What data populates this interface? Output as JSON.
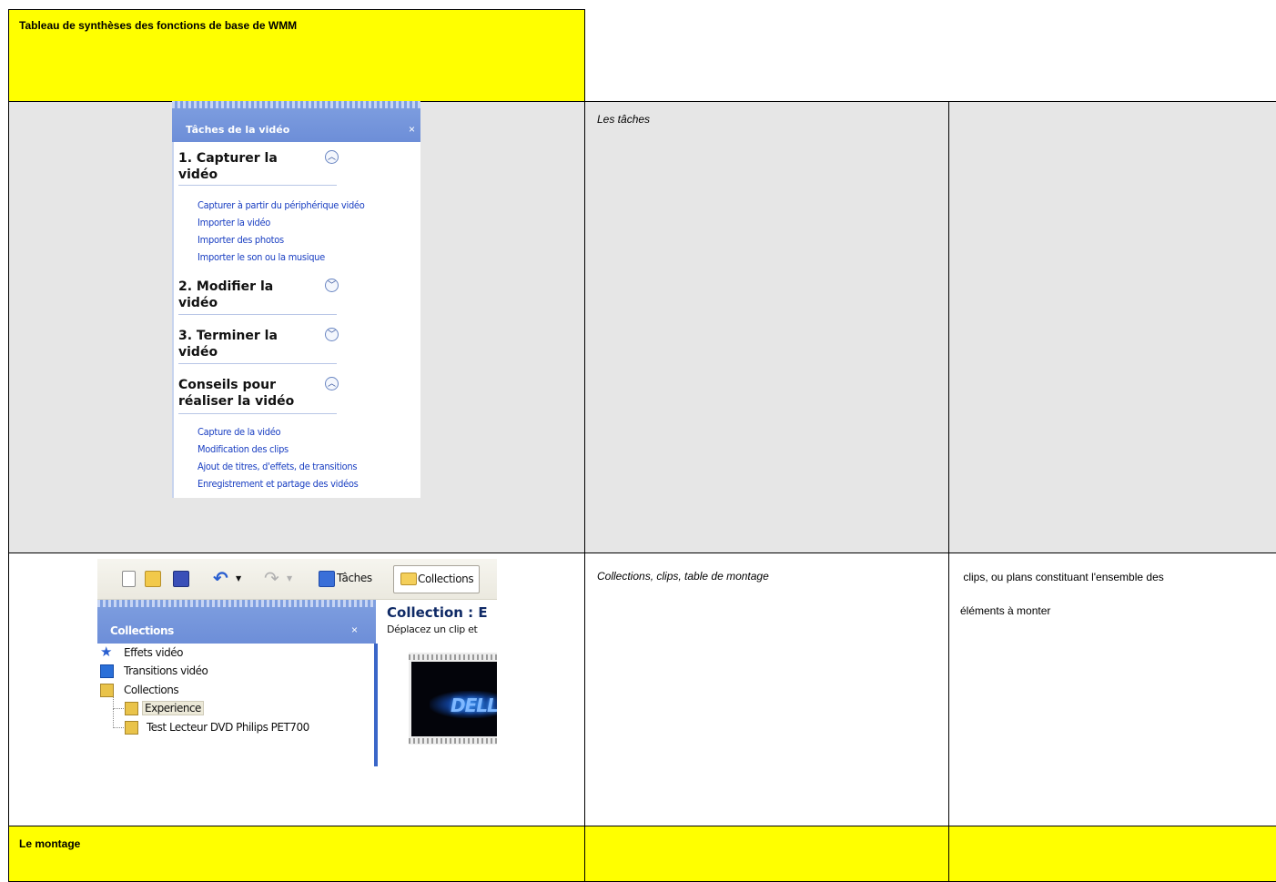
{
  "table": {
    "title": "Tableau de synthèses des fonctions de base de WMM",
    "rows": [
      {
        "col2": "Les tâches",
        "col3": ""
      },
      {
        "col2": "Collections, clips, table de montage",
        "col3_line1": " clips, ou plans constituant l'ensemble des",
        "col3_line2": "éléments à monter"
      },
      {
        "col1": "Le montage",
        "col2": "",
        "col3": ""
      }
    ]
  },
  "task_pane": {
    "title": "Tâches de la vidéo",
    "close": "×",
    "sections": [
      {
        "line1": "1. Capturer la",
        "line2": "vidéo",
        "state": "expanded",
        "links": [
          "Capturer à partir du périphérique vidéo",
          "Importer la vidéo",
          "Importer des photos",
          "Importer le son ou la musique"
        ]
      },
      {
        "line1": "2. Modifier la",
        "line2": "vidéo",
        "state": "collapsed"
      },
      {
        "line1": "3. Terminer la",
        "line2": "vidéo",
        "state": "collapsed"
      },
      {
        "line1": "Conseils pour",
        "line2": "réaliser la vidéo",
        "state": "expanded",
        "links": [
          "Capture de la vidéo",
          "Modification des clips",
          "Ajout de titres, d'effets, de transitions",
          "Enregistrement et partage des vidéos"
        ]
      }
    ]
  },
  "collections_pane": {
    "toolbar": {
      "taches": "Tâches",
      "collections": "Collections"
    },
    "panel_title": "Collections",
    "close": "×",
    "tree": [
      "Effets vidéo",
      "Transitions vidéo",
      "Collections",
      "Experience",
      "Test Lecteur DVD Philips PET700"
    ],
    "content_title": "Collection : E",
    "content_subtitle": "Déplacez un clip et",
    "thumbnail_logo": "DELL"
  },
  "colors": {
    "yellow": "#ffff00",
    "grey": "#e6e6e6",
    "link_blue": "#1a3fc2",
    "pane_blue": "#7f9fe0"
  }
}
